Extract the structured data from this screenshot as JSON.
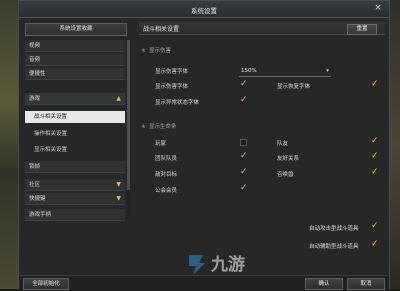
{
  "window": {
    "title": "系统设置",
    "close": "×"
  },
  "left": {
    "preset_button": "系统设置收藏",
    "nav": {
      "video": "视频",
      "audio": "音频",
      "convenience": "便捷性",
      "game": "游戏",
      "game_sub": [
        "战斗相关设置",
        "操作相关设置",
        "显示相关设置"
      ],
      "lock": "锁帧",
      "social": "社区",
      "shortcut": "快捷键",
      "gamepad": "游戏手柄"
    }
  },
  "right": {
    "header_title": "战斗相关设置",
    "reset_button": "重置",
    "damage": {
      "section": "显示伤害",
      "font_label": "显示伤害字体",
      "font_value": "150%",
      "damage_font": "显示伤害字体",
      "heal_font": "显示恢复字体",
      "abnormal_font": "显示异常状态字体"
    },
    "life": {
      "section": "显示生命条",
      "player": "玩家",
      "party": "队友",
      "raid": "团队队员",
      "friend": "友好关系",
      "enemy": "敌对目标",
      "summon": "召唤兽",
      "guild": "公会会员"
    },
    "items": [
      "自动攻击型战斗道具",
      "自动辅助型战斗道具"
    ]
  },
  "bottom": {
    "reset_all": "全部初始化",
    "confirm": "确认",
    "cancel": "取消"
  },
  "watermark": "九游",
  "colors": {
    "check": "#e7c24a",
    "window": "#262827"
  }
}
